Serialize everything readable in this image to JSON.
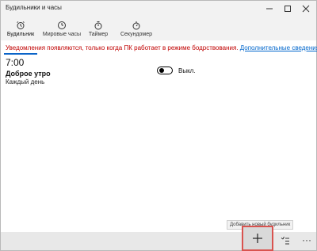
{
  "window": {
    "title": "Будильники и часы"
  },
  "tabs": [
    {
      "label": "Будильник",
      "icon": "alarm-clock-icon",
      "active": true
    },
    {
      "label": "Мировые часы",
      "icon": "world-clock-icon",
      "active": false
    },
    {
      "label": "Таймер",
      "icon": "timer-icon",
      "active": false
    },
    {
      "label": "Секундомер",
      "icon": "stopwatch-icon",
      "active": false
    }
  ],
  "notice": {
    "warning": "Уведомления появляются, только когда ПК работает в режиме бодрствования.",
    "link": "Дополнительные сведения"
  },
  "alarm": {
    "time": "7:00",
    "name": "Доброе утро",
    "repeat": "Каждый день",
    "state_label": "Выкл.",
    "enabled": false
  },
  "commandbar": {
    "tooltip": "Добавить новый будильник",
    "add_icon": "plus-icon",
    "select_icon": "select-list-icon",
    "more_label": "···"
  },
  "colors": {
    "accent": "#0a64c8",
    "warning": "#c00000",
    "link": "#0066cc",
    "highlight": "#d9534f"
  }
}
